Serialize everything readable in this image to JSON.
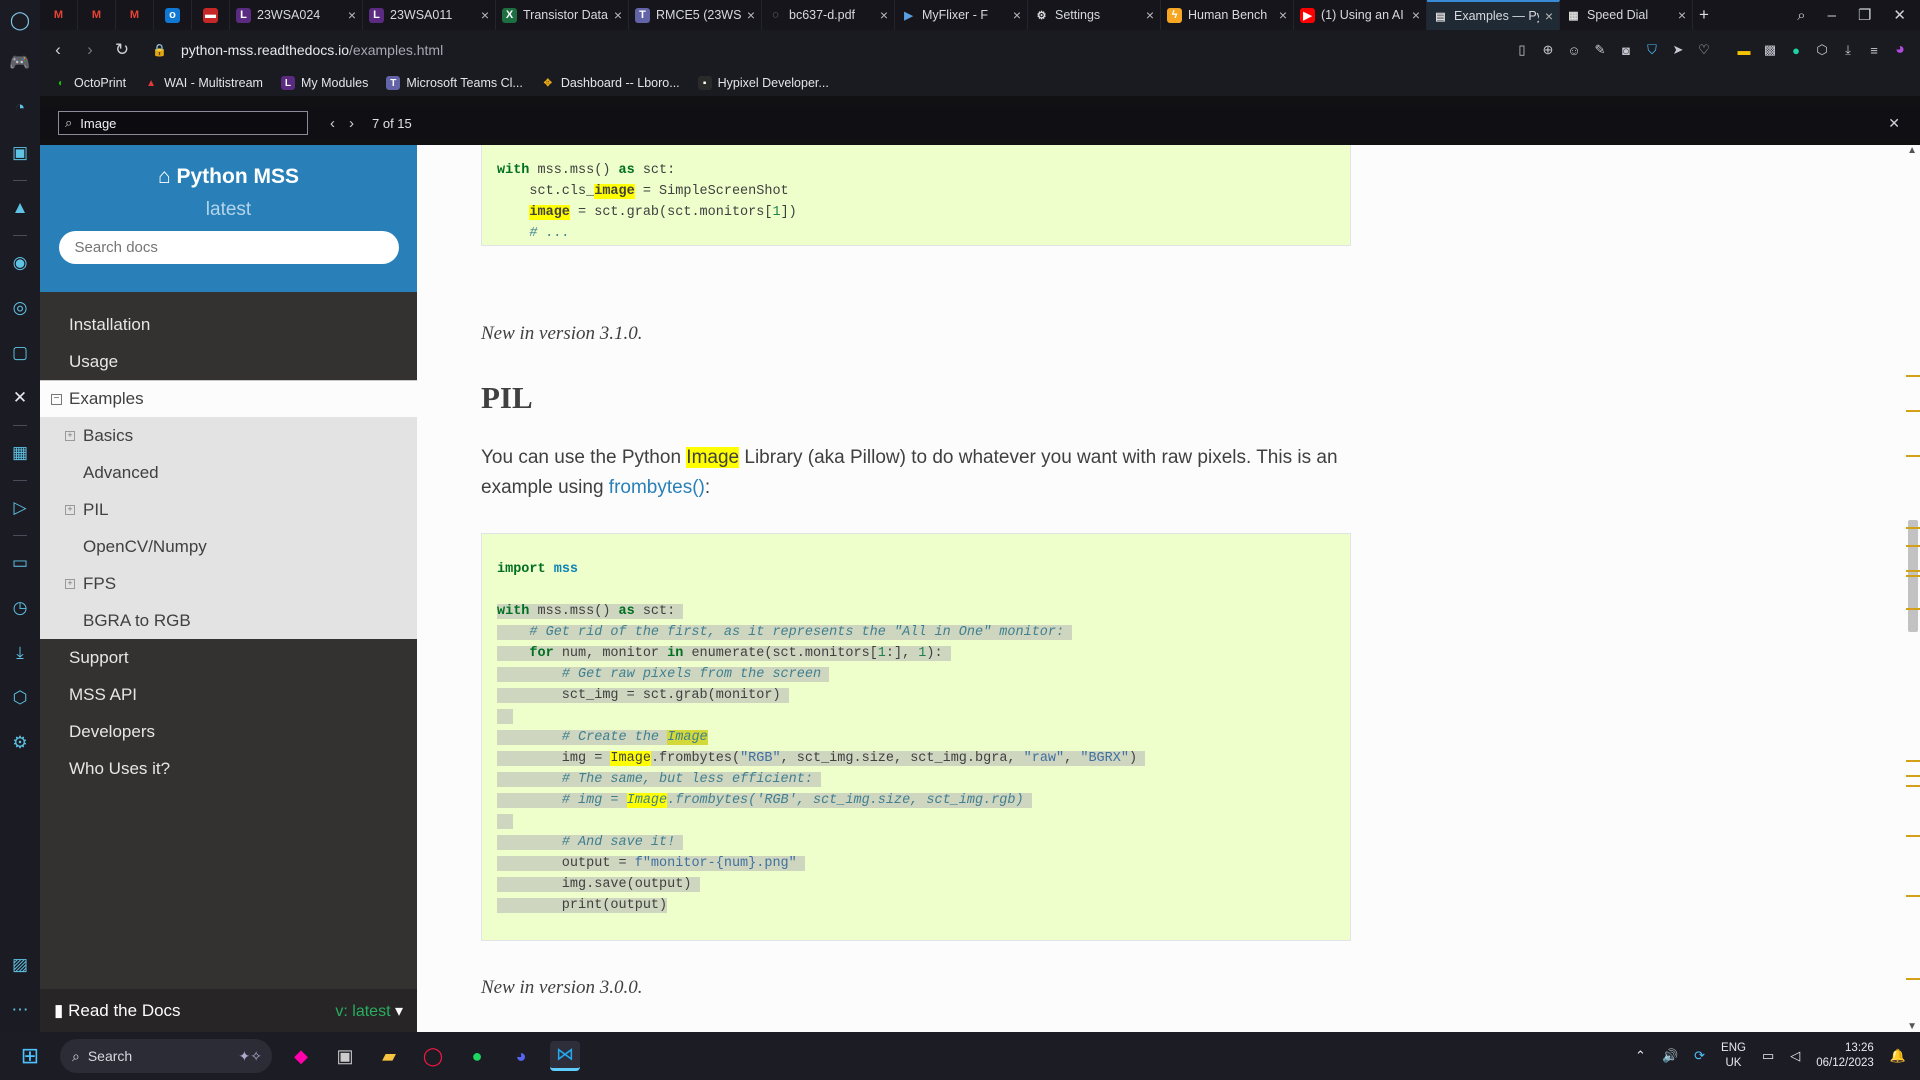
{
  "browser": {
    "tabs": [
      {
        "label": "",
        "icon": "gmail-icon",
        "color": "#ea4335"
      },
      {
        "label": "",
        "icon": "gmail-icon",
        "color": "#ea4335"
      },
      {
        "label": "",
        "icon": "gmail-icon",
        "color": "#ea4335"
      },
      {
        "label": "",
        "icon": "outlook-icon",
        "color": "#0f78d4"
      },
      {
        "label": "",
        "icon": "red-app-icon",
        "color": "#c62828"
      },
      {
        "label": "23WSA024",
        "icon": "learn-icon",
        "color": "#5b2b82"
      },
      {
        "label": "23WSA011",
        "icon": "learn-icon",
        "color": "#5b2b82"
      },
      {
        "label": "Transistor Data",
        "icon": "excel-icon",
        "color": "#1d6f42"
      },
      {
        "label": "RMCE5 (23WS",
        "icon": "teams-icon",
        "color": "#6264a7"
      },
      {
        "label": "bc637-d.pdf",
        "icon": "loading-icon",
        "color": "#888888"
      },
      {
        "label": "MyFlixer - F",
        "icon": "play-icon",
        "color": "#2b6cb0"
      },
      {
        "label": "Settings",
        "icon": "gear-icon",
        "color": "#cccccc"
      },
      {
        "label": "Human Bench",
        "icon": "lightning-icon",
        "color": "#f6a623"
      },
      {
        "label": "(1) Using an AI",
        "icon": "youtube-icon",
        "color": "#ff0000"
      },
      {
        "label": "Examples — Py",
        "icon": "docs-icon",
        "color": "#cccccc"
      },
      {
        "label": "Speed Dial",
        "icon": "speed-dial-icon",
        "color": "#cccccc"
      }
    ],
    "url_domain": "python-mss.readthedocs.io",
    "url_path": "/examples.html",
    "bookmarks": [
      {
        "label": "OctoPrint",
        "color": "#13c100"
      },
      {
        "label": "WAI - Multistream",
        "color": "#e23a3a"
      },
      {
        "label": "My Modules",
        "color": "#5b2b82"
      },
      {
        "label": "Microsoft Teams Cl...",
        "color": "#6264a7"
      },
      {
        "label": "Dashboard -- Lboro...",
        "color": "#e6a817"
      },
      {
        "label": "Hypixel Developer...",
        "color": "#2a2a2a"
      }
    ],
    "find": {
      "query": "Image",
      "count": "7 of 15"
    }
  },
  "sidebar": {
    "title": "Python MSS",
    "version": "latest",
    "search_placeholder": "Search docs",
    "menu": {
      "installation": "Installation",
      "usage": "Usage",
      "examples": "Examples",
      "sub": {
        "basics": "Basics",
        "advanced": "Advanced",
        "pil": "PIL",
        "opencv": "OpenCV/Numpy",
        "fps": "FPS",
        "bgra": "BGRA to RGB"
      },
      "support": "Support",
      "api": "MSS API",
      "developers": "Developers",
      "who": "Who Uses it?"
    },
    "footer_name": "Read the Docs",
    "footer_version": "v: latest"
  },
  "content": {
    "version_note_1": "New in version 3.1.0.",
    "heading": "PIL",
    "para_before": "You can use the Python ",
    "para_hl": "Image",
    "para_after": " Library (aka Pillow) to do whatever you want with raw pixels. This is an example using ",
    "para_link": "frombytes()",
    "para_end": ":",
    "version_note_2": "New in version 3.0.0."
  },
  "taskbar": {
    "search_label": "Search",
    "lang_line1": "ENG",
    "lang_line2": "UK",
    "time": "13:26",
    "date": "06/12/2023"
  }
}
